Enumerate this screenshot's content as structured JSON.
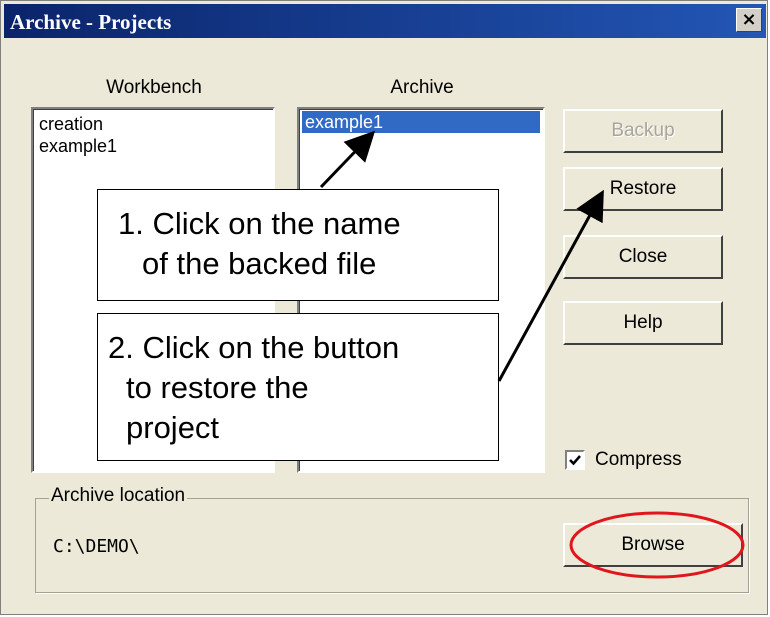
{
  "window": {
    "title": "Archive - Projects",
    "close_glyph": "×"
  },
  "workbench": {
    "heading": "Workbench",
    "items": [
      "creation",
      "example1"
    ]
  },
  "archive": {
    "heading": "Archive",
    "items": [
      "example1"
    ],
    "selected": "example1"
  },
  "buttons": {
    "backup": "Backup",
    "restore": "Restore",
    "close": "Close",
    "help": "Help",
    "browse": "Browse"
  },
  "compress": {
    "label": "Compress",
    "checked": true
  },
  "location": {
    "group_label": "Archive location",
    "path": "C:\\DEMO\\"
  },
  "callouts": {
    "step1_line1": "1.  Click on the name",
    "step1_line2": "of the backed file",
    "step2_line1": "2. Click on the button",
    "step2_line2": "to restore the",
    "step2_line3": "project"
  },
  "colors": {
    "title_bar": "#0a246a",
    "selection": "#316ac5",
    "highlight_ring": "#e0161c",
    "dialog_bg": "#ece9d8"
  }
}
